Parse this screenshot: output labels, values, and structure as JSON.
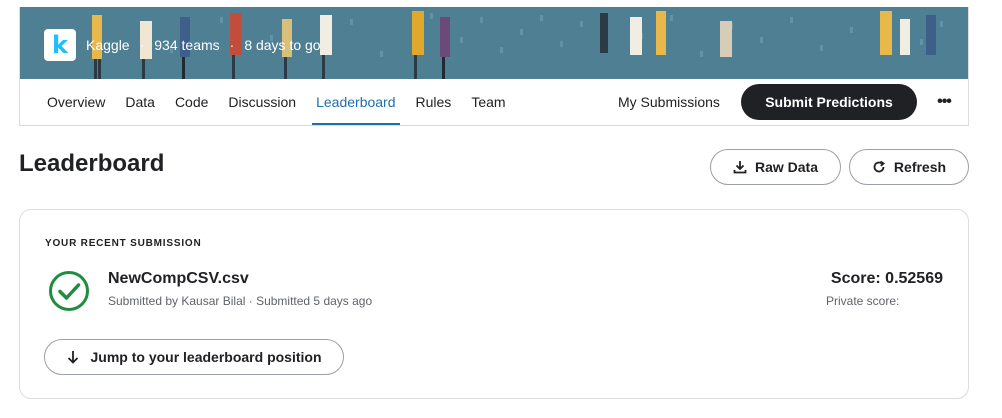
{
  "header": {
    "brand_name": "Kaggle",
    "teams": "934 teams",
    "time_left": "8 days to go",
    "separator": "·",
    "logo_letter": "k",
    "banner_color": "#4f7f93"
  },
  "tabs": [
    {
      "label": "Overview"
    },
    {
      "label": "Data"
    },
    {
      "label": "Code"
    },
    {
      "label": "Discussion"
    },
    {
      "label": "Leaderboard",
      "active": true
    },
    {
      "label": "Rules"
    },
    {
      "label": "Team"
    }
  ],
  "actions": {
    "my_submissions": "My Submissions",
    "submit_predictions": "Submit Predictions",
    "more": "•••"
  },
  "page": {
    "title": "Leaderboard",
    "raw_data": "Raw Data",
    "refresh": "Refresh"
  },
  "submission": {
    "heading": "YOUR RECENT SUBMISSION",
    "file_name": "NewCompCSV.csv",
    "meta": "Submitted by Kausar Bilal · Submitted 5 days ago",
    "score": "Score: 0.52569",
    "private_score": "Private score:",
    "jump_button": "Jump to your leaderboard position",
    "status_color": "#1e8e3e"
  }
}
